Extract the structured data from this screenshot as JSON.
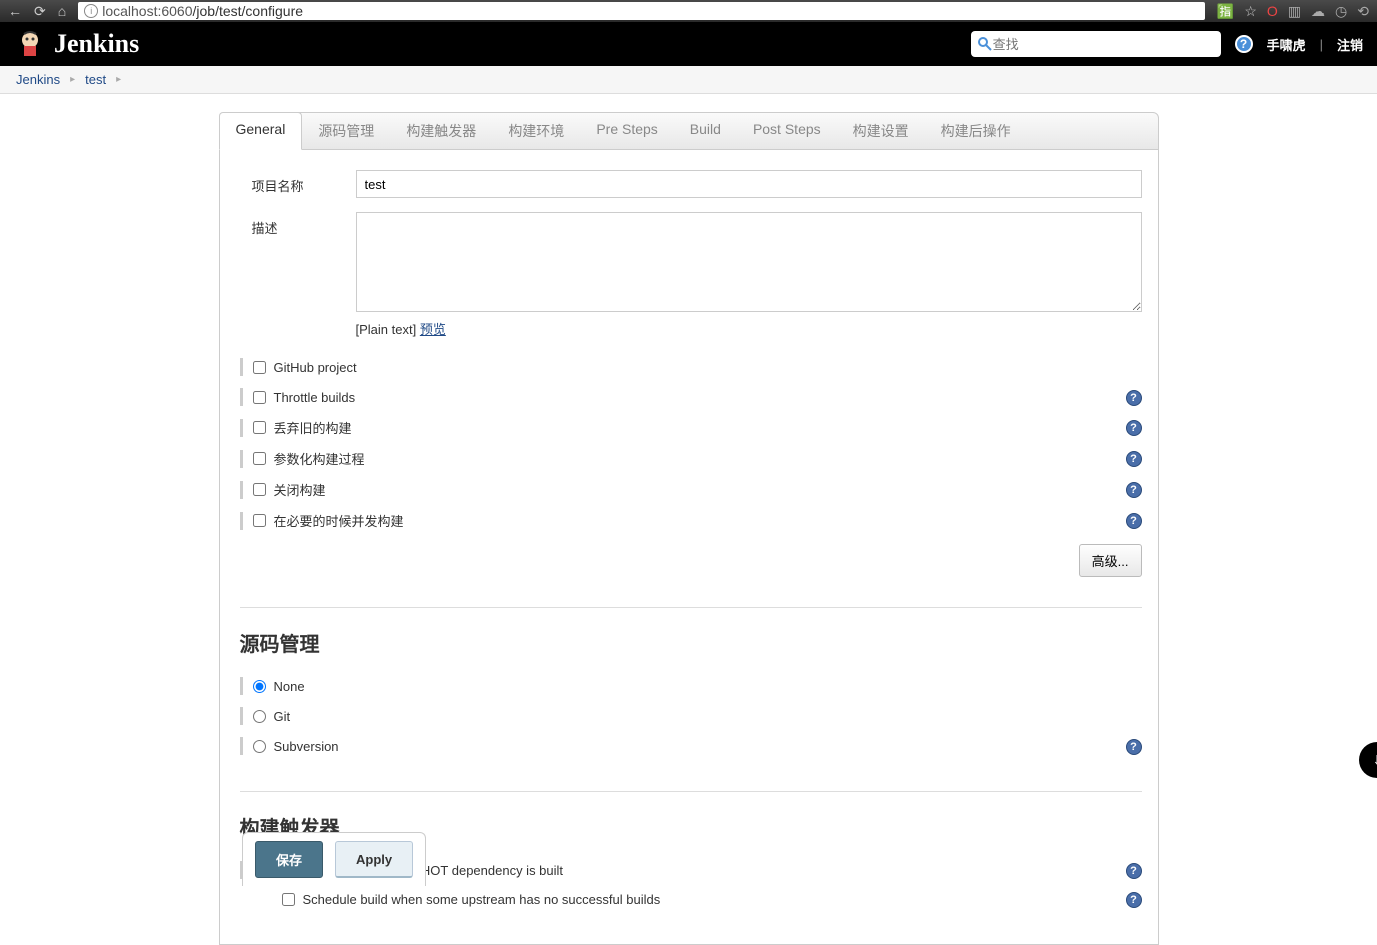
{
  "browser": {
    "url_host": "localhost",
    "url_port": ":6060",
    "url_path": "/job/test/configure"
  },
  "header": {
    "brand": "Jenkins",
    "search_placeholder": "查找",
    "user": "手啸虎",
    "logout": "注销"
  },
  "breadcrumb": {
    "root": "Jenkins",
    "item": "test"
  },
  "tabs": [
    "General",
    "源码管理",
    "构建触发器",
    "构建环境",
    "Pre Steps",
    "Build",
    "Post Steps",
    "构建设置",
    "构建后操作"
  ],
  "active_tab": 0,
  "form": {
    "project_name_label": "项目名称",
    "project_name_value": "test",
    "description_label": "描述",
    "description_value": "",
    "plaintext_label": "[Plain text]",
    "preview_link": "预览"
  },
  "options": [
    {
      "label": "GitHub project",
      "checked": false,
      "help": false
    },
    {
      "label": "Throttle builds",
      "checked": false,
      "help": true
    },
    {
      "label": "丢弃旧的构建",
      "checked": false,
      "help": true
    },
    {
      "label": "参数化构建过程",
      "checked": false,
      "help": true
    },
    {
      "label": "关闭构建",
      "checked": false,
      "help": true
    },
    {
      "label": "在必要的时候并发构建",
      "checked": false,
      "help": true
    }
  ],
  "advanced_button": "高级...",
  "scm": {
    "title": "源码管理",
    "options": [
      {
        "label": "None",
        "checked": true,
        "help": false
      },
      {
        "label": "Git",
        "checked": false,
        "help": false
      },
      {
        "label": "Subversion",
        "checked": false,
        "help": true
      }
    ]
  },
  "triggers": {
    "title": "构建触发器",
    "items": [
      {
        "label": "Build whenever a SNAPSHOT dependency is built",
        "checked": true,
        "help": true
      }
    ],
    "subitem": {
      "label": "Schedule build when some upstream has no successful builds",
      "checked": false,
      "help": true
    }
  },
  "buttons": {
    "save": "保存",
    "apply": "Apply"
  }
}
